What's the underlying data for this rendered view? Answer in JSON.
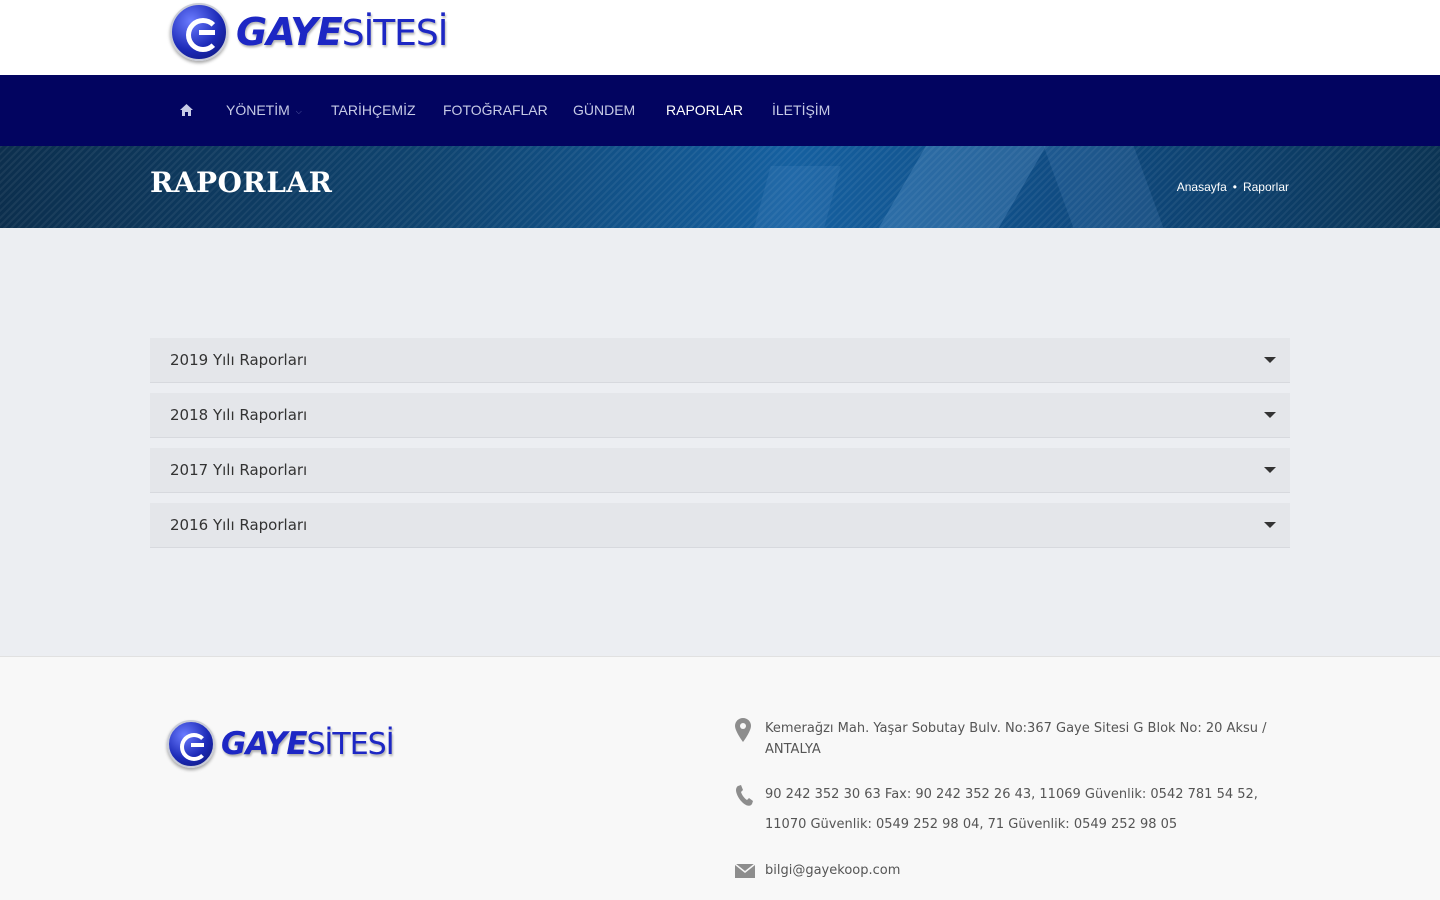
{
  "brand": {
    "bold": "GAYE",
    "light": "SİTESİ",
    "accent_color": "#1d27c4"
  },
  "nav": {
    "home_icon": "home-icon",
    "items": [
      {
        "label": "YÖNETİM",
        "has_submenu": true
      },
      {
        "label": "TARİHÇEMİZ"
      },
      {
        "label": "FOTOĞRAFLAR"
      },
      {
        "label": "GÜNDEM"
      },
      {
        "label": "RAPORLAR",
        "active": true
      },
      {
        "label": "İLETİŞİM"
      }
    ],
    "bg_color": "#020460"
  },
  "banner": {
    "title": "RAPORLAR",
    "breadcrumb": {
      "home": "Anasayfa",
      "separator": "•",
      "current": "Raporlar"
    }
  },
  "accordion": [
    {
      "title": "2019 Yılı Raporları"
    },
    {
      "title": "2018 Yılı Raporları"
    },
    {
      "title": "2017 Yılı Raporları"
    },
    {
      "title": "2016 Yılı Raporları"
    }
  ],
  "footer": {
    "address": "Kemerağzı Mah. Yaşar Sobutay Bulv. No:367 Gaye Sitesi G Blok No: 20 Aksu / ANTALYA",
    "phone": "90 242 352 30 63 Fax: 90 242 352 26 43, 11069 Güvenlik: 0542 781 54 52, 11070 Güvenlik: 0549 252 98 04, 71 Güvenlik: 0549 252 98 05",
    "email": "bilgi@gayekoop.com",
    "icons": [
      "map-pin-icon",
      "phone-icon",
      "mail-icon"
    ]
  }
}
